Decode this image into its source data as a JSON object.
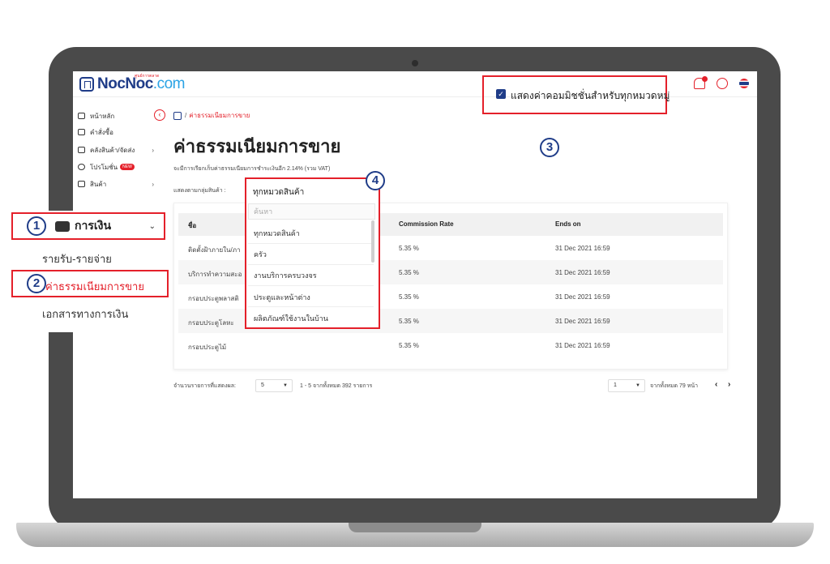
{
  "brand": {
    "name_main": "NocNoc",
    "name_suffix": ".com",
    "tagline": "ศูนย์การตลาด"
  },
  "sidebar": {
    "items": [
      {
        "label": "หน้าหลัก",
        "icon": "home-icon",
        "arrow": ""
      },
      {
        "label": "คำสั่งซื้อ",
        "icon": "order-icon",
        "arrow": ""
      },
      {
        "label": "คลังสินค้า/จัดส่ง",
        "icon": "warehouse-icon",
        "arrow": "›"
      },
      {
        "label": "โปรโมชั่น",
        "icon": "promotion-icon",
        "arrow": "",
        "badge": "NEW"
      },
      {
        "label": "สินค้า",
        "icon": "product-icon",
        "arrow": "›"
      }
    ],
    "finance": {
      "label": "การเงิน",
      "arrow": "⌄",
      "subitems": [
        "รายรับ-รายจ่าย",
        "ค่าธรรมเนียมการขาย",
        "เอกสารทางการเงิน"
      ]
    }
  },
  "callouts": [
    "1",
    "2",
    "3",
    "4"
  ],
  "breadcrumb": {
    "separator": "/",
    "current": "ค่าธรรมเนียมการขาย"
  },
  "page": {
    "title": "ค่าธรรมเนียมการขาย",
    "fee_note": "จะมีการเรียกเก็บค่าธรรมเนียมการชำระเงินอีก 2.14% (รวม VAT)",
    "group_label": "แสดงตามกลุ่มสินค้า :",
    "show_all_label": "แสดงค่าคอมมิชชั่นสำหรับทุกหมวดหมู่",
    "show_all_checked": true
  },
  "dropdown": {
    "selected": "ทุกหมวดสินค้า",
    "search_placeholder": "ค้นหา",
    "options": [
      "ทุกหมวดสินค้า",
      "ครัว",
      "งานบริการครบวงจร",
      "ประตูและหน้าต่าง",
      "ผลิตภัณฑ์ใช้งานในบ้าน"
    ]
  },
  "table": {
    "headers": [
      "ชื่อ",
      "Commission Rate",
      "Ends on"
    ],
    "rows": [
      {
        "name": "ติดตั้งฝ้าภายใน/ภา",
        "rate": "5.35 %",
        "ends": "31 Dec 2021 16:59"
      },
      {
        "name": "บริการทำความสะอ",
        "rate": "5.35 %",
        "ends": "31 Dec 2021 16:59"
      },
      {
        "name": "กรอบประตูพลาสติ",
        "rate": "5.35 %",
        "ends": "31 Dec 2021 16:59"
      },
      {
        "name": "กรอบประตูโลหะ",
        "rate": "5.35 %",
        "ends": "31 Dec 2021 16:59"
      },
      {
        "name": "กรอบประตูไม้",
        "rate": "5.35 %",
        "ends": "31 Dec 2021 16:59"
      }
    ]
  },
  "pagination": {
    "per_page_label": "จำนวนรายการที่แสดงผล:",
    "per_page": "5",
    "range_text": "1 - 5 จากทั้งหมด 392 รายการ",
    "page": "1",
    "total_pages_text": "จากทั้งหมด 79 หน้า",
    "prev": "‹",
    "next": "›"
  },
  "colors": {
    "accent": "#e4202a",
    "brand": "#1f3c88"
  }
}
